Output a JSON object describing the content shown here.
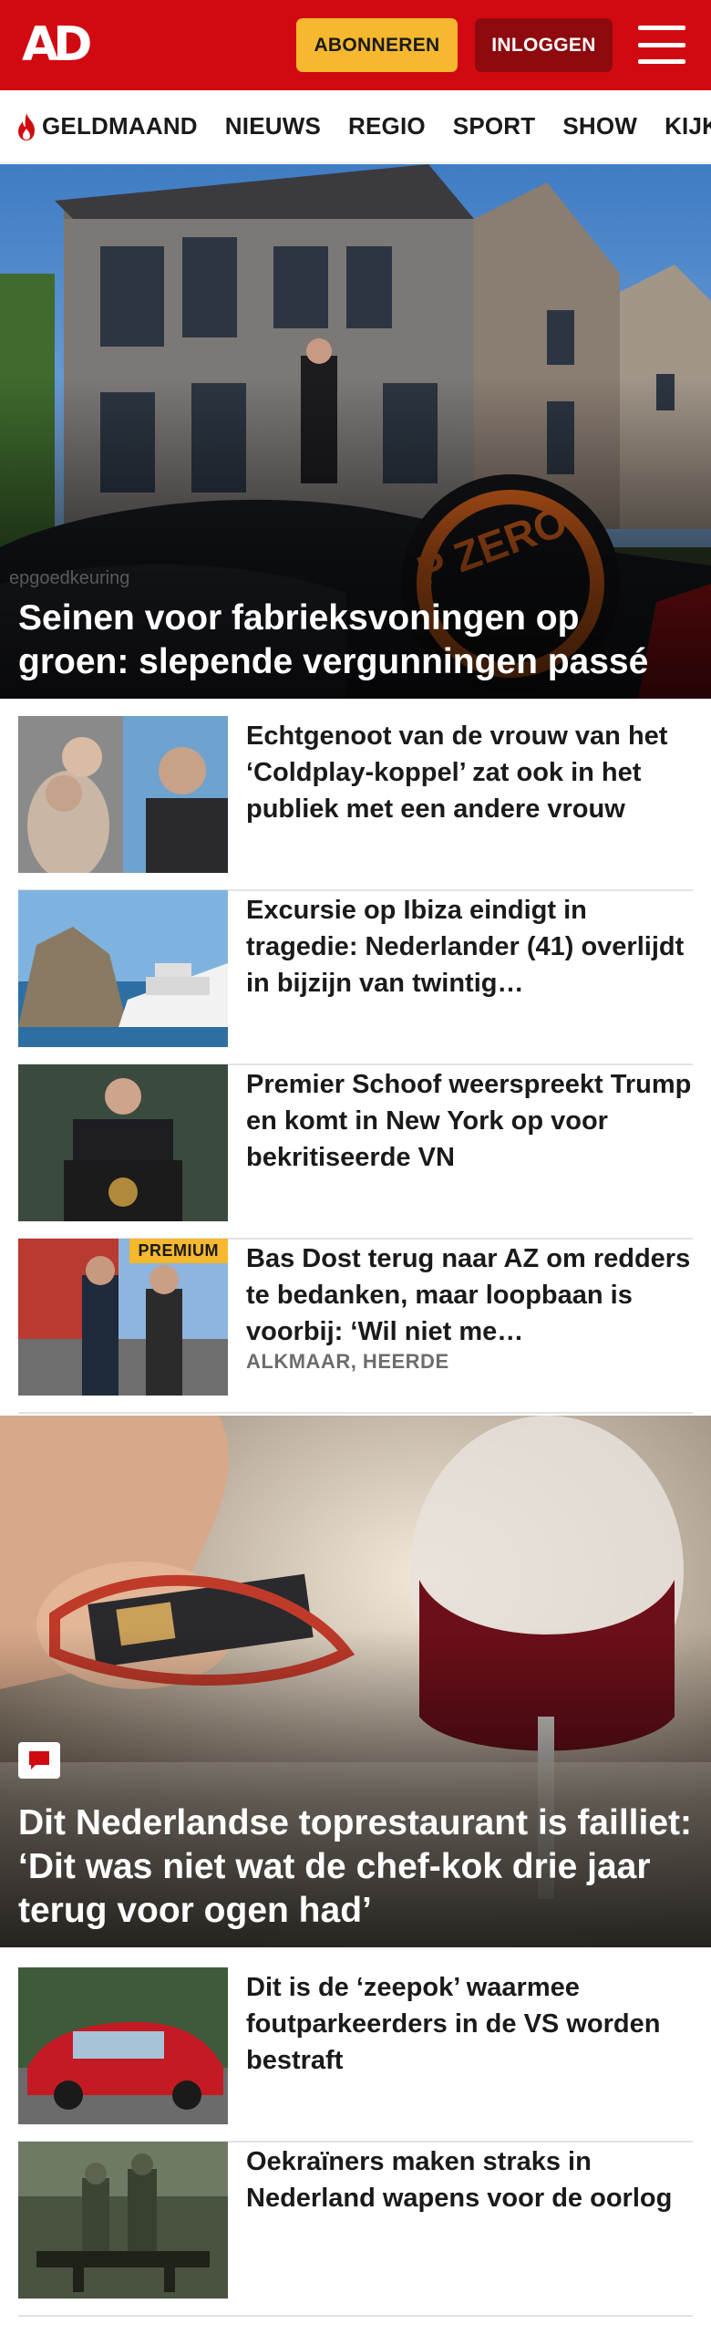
{
  "header": {
    "logo_text": "AD",
    "subscribe_label": "ABONNEREN",
    "login_label": "INLOGGEN",
    "brand_color": "#d10a11"
  },
  "nav": {
    "items": [
      {
        "label": "GELDMAAND",
        "icon": "flame-icon"
      },
      {
        "label": "NIEUWS"
      },
      {
        "label": "REGIO"
      },
      {
        "label": "SPORT"
      },
      {
        "label": "SHOW"
      },
      {
        "label": "KIJK"
      }
    ]
  },
  "hero1": {
    "title": "Seinen voor fabrieksvoningen op groen: slepende vergunningen passé"
  },
  "articles": [
    {
      "title": "Echtgenoot van de vrouw van het ‘Coldplay-koppel’ zat ook in het publiek met een andere vrouw"
    },
    {
      "title": "Excursie op Ibiza eindigt in tragedie: Nederlander (41) overlijdt in bijzijn van twintig…"
    },
    {
      "title": "Premier Schoof weerspreekt Trump en komt in New York op voor bekritiseerde VN"
    },
    {
      "title": "Bas Dost terug naar AZ om redders te bedanken, maar loopbaan is voorbij: ‘Wil niet me…",
      "meta": "ALKMAAR, HEERDE",
      "badge": "PREMIUM"
    }
  ],
  "hero2": {
    "title": "Dit Nederlandse toprestaurant is failliet: ‘Dit was niet wat de chef-kok drie jaar terug voor ogen had’",
    "badge_icon": "comment-icon"
  },
  "articles2": [
    {
      "title": "Dit is de ‘zeepok’ waarmee foutparkeerders in de VS worden bestraft"
    },
    {
      "title": "Oekraïners maken straks in Nederland wapens voor de oorlog"
    }
  ]
}
